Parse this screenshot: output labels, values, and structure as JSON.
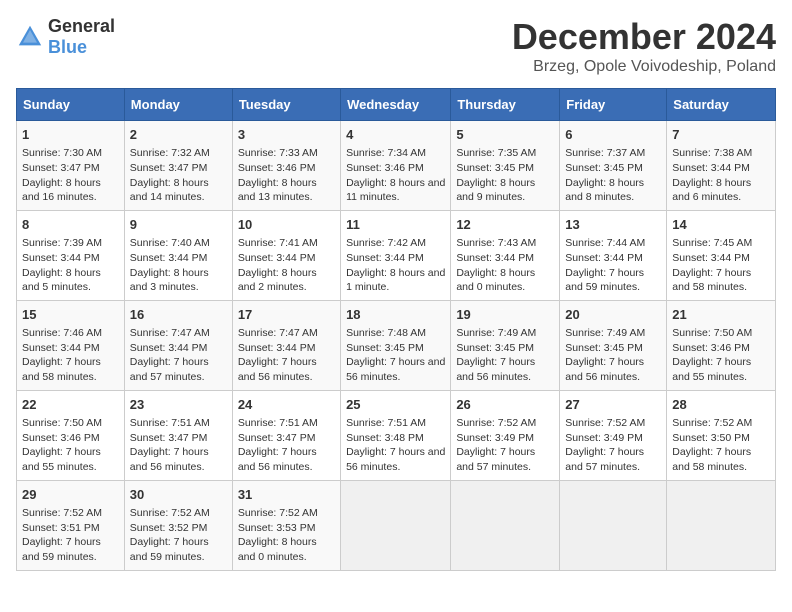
{
  "header": {
    "logo_general": "General",
    "logo_blue": "Blue",
    "title": "December 2024",
    "location": "Brzeg, Opole Voivodeship, Poland"
  },
  "days_of_week": [
    "Sunday",
    "Monday",
    "Tuesday",
    "Wednesday",
    "Thursday",
    "Friday",
    "Saturday"
  ],
  "weeks": [
    [
      {
        "day": "1",
        "sunrise": "Sunrise: 7:30 AM",
        "sunset": "Sunset: 3:47 PM",
        "daylight": "Daylight: 8 hours and 16 minutes."
      },
      {
        "day": "2",
        "sunrise": "Sunrise: 7:32 AM",
        "sunset": "Sunset: 3:47 PM",
        "daylight": "Daylight: 8 hours and 14 minutes."
      },
      {
        "day": "3",
        "sunrise": "Sunrise: 7:33 AM",
        "sunset": "Sunset: 3:46 PM",
        "daylight": "Daylight: 8 hours and 13 minutes."
      },
      {
        "day": "4",
        "sunrise": "Sunrise: 7:34 AM",
        "sunset": "Sunset: 3:46 PM",
        "daylight": "Daylight: 8 hours and 11 minutes."
      },
      {
        "day": "5",
        "sunrise": "Sunrise: 7:35 AM",
        "sunset": "Sunset: 3:45 PM",
        "daylight": "Daylight: 8 hours and 9 minutes."
      },
      {
        "day": "6",
        "sunrise": "Sunrise: 7:37 AM",
        "sunset": "Sunset: 3:45 PM",
        "daylight": "Daylight: 8 hours and 8 minutes."
      },
      {
        "day": "7",
        "sunrise": "Sunrise: 7:38 AM",
        "sunset": "Sunset: 3:44 PM",
        "daylight": "Daylight: 8 hours and 6 minutes."
      }
    ],
    [
      {
        "day": "8",
        "sunrise": "Sunrise: 7:39 AM",
        "sunset": "Sunset: 3:44 PM",
        "daylight": "Daylight: 8 hours and 5 minutes."
      },
      {
        "day": "9",
        "sunrise": "Sunrise: 7:40 AM",
        "sunset": "Sunset: 3:44 PM",
        "daylight": "Daylight: 8 hours and 3 minutes."
      },
      {
        "day": "10",
        "sunrise": "Sunrise: 7:41 AM",
        "sunset": "Sunset: 3:44 PM",
        "daylight": "Daylight: 8 hours and 2 minutes."
      },
      {
        "day": "11",
        "sunrise": "Sunrise: 7:42 AM",
        "sunset": "Sunset: 3:44 PM",
        "daylight": "Daylight: 8 hours and 1 minute."
      },
      {
        "day": "12",
        "sunrise": "Sunrise: 7:43 AM",
        "sunset": "Sunset: 3:44 PM",
        "daylight": "Daylight: 8 hours and 0 minutes."
      },
      {
        "day": "13",
        "sunrise": "Sunrise: 7:44 AM",
        "sunset": "Sunset: 3:44 PM",
        "daylight": "Daylight: 7 hours and 59 minutes."
      },
      {
        "day": "14",
        "sunrise": "Sunrise: 7:45 AM",
        "sunset": "Sunset: 3:44 PM",
        "daylight": "Daylight: 7 hours and 58 minutes."
      }
    ],
    [
      {
        "day": "15",
        "sunrise": "Sunrise: 7:46 AM",
        "sunset": "Sunset: 3:44 PM",
        "daylight": "Daylight: 7 hours and 58 minutes."
      },
      {
        "day": "16",
        "sunrise": "Sunrise: 7:47 AM",
        "sunset": "Sunset: 3:44 PM",
        "daylight": "Daylight: 7 hours and 57 minutes."
      },
      {
        "day": "17",
        "sunrise": "Sunrise: 7:47 AM",
        "sunset": "Sunset: 3:44 PM",
        "daylight": "Daylight: 7 hours and 56 minutes."
      },
      {
        "day": "18",
        "sunrise": "Sunrise: 7:48 AM",
        "sunset": "Sunset: 3:45 PM",
        "daylight": "Daylight: 7 hours and 56 minutes."
      },
      {
        "day": "19",
        "sunrise": "Sunrise: 7:49 AM",
        "sunset": "Sunset: 3:45 PM",
        "daylight": "Daylight: 7 hours and 56 minutes."
      },
      {
        "day": "20",
        "sunrise": "Sunrise: 7:49 AM",
        "sunset": "Sunset: 3:45 PM",
        "daylight": "Daylight: 7 hours and 56 minutes."
      },
      {
        "day": "21",
        "sunrise": "Sunrise: 7:50 AM",
        "sunset": "Sunset: 3:46 PM",
        "daylight": "Daylight: 7 hours and 55 minutes."
      }
    ],
    [
      {
        "day": "22",
        "sunrise": "Sunrise: 7:50 AM",
        "sunset": "Sunset: 3:46 PM",
        "daylight": "Daylight: 7 hours and 55 minutes."
      },
      {
        "day": "23",
        "sunrise": "Sunrise: 7:51 AM",
        "sunset": "Sunset: 3:47 PM",
        "daylight": "Daylight: 7 hours and 56 minutes."
      },
      {
        "day": "24",
        "sunrise": "Sunrise: 7:51 AM",
        "sunset": "Sunset: 3:47 PM",
        "daylight": "Daylight: 7 hours and 56 minutes."
      },
      {
        "day": "25",
        "sunrise": "Sunrise: 7:51 AM",
        "sunset": "Sunset: 3:48 PM",
        "daylight": "Daylight: 7 hours and 56 minutes."
      },
      {
        "day": "26",
        "sunrise": "Sunrise: 7:52 AM",
        "sunset": "Sunset: 3:49 PM",
        "daylight": "Daylight: 7 hours and 57 minutes."
      },
      {
        "day": "27",
        "sunrise": "Sunrise: 7:52 AM",
        "sunset": "Sunset: 3:49 PM",
        "daylight": "Daylight: 7 hours and 57 minutes."
      },
      {
        "day": "28",
        "sunrise": "Sunrise: 7:52 AM",
        "sunset": "Sunset: 3:50 PM",
        "daylight": "Daylight: 7 hours and 58 minutes."
      }
    ],
    [
      {
        "day": "29",
        "sunrise": "Sunrise: 7:52 AM",
        "sunset": "Sunset: 3:51 PM",
        "daylight": "Daylight: 7 hours and 59 minutes."
      },
      {
        "day": "30",
        "sunrise": "Sunrise: 7:52 AM",
        "sunset": "Sunset: 3:52 PM",
        "daylight": "Daylight: 7 hours and 59 minutes."
      },
      {
        "day": "31",
        "sunrise": "Sunrise: 7:52 AM",
        "sunset": "Sunset: 3:53 PM",
        "daylight": "Daylight: 8 hours and 0 minutes."
      },
      {
        "day": "",
        "sunrise": "",
        "sunset": "",
        "daylight": ""
      },
      {
        "day": "",
        "sunrise": "",
        "sunset": "",
        "daylight": ""
      },
      {
        "day": "",
        "sunrise": "",
        "sunset": "",
        "daylight": ""
      },
      {
        "day": "",
        "sunrise": "",
        "sunset": "",
        "daylight": ""
      }
    ]
  ]
}
